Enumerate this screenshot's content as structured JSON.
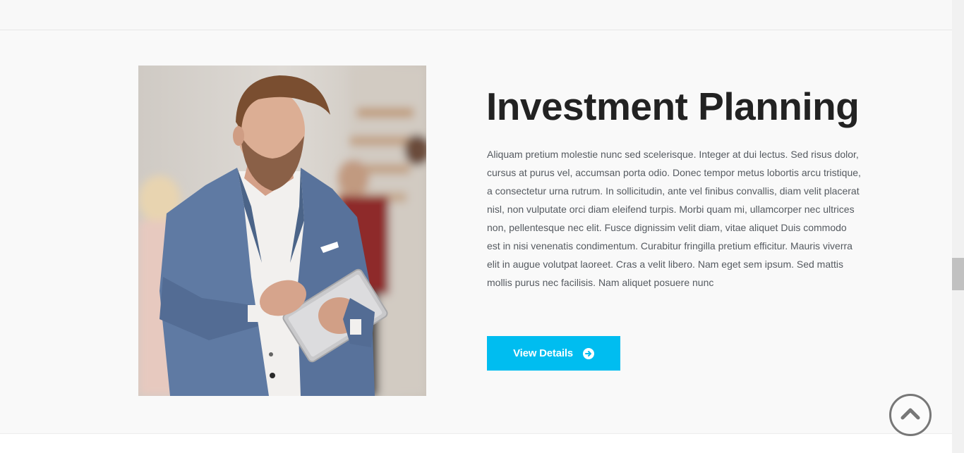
{
  "section": {
    "title": "Investment Planning",
    "description": "Aliquam pretium molestie nunc sed scelerisque. Integer at dui lectus. Sed risus dolor, cursus at purus vel, accumsan porta odio. Donec tempor metus lobortis arcu tristique, a consectetur urna rutrum. In sollicitudin, ante vel finibus convallis, diam velit placerat nisl, non vulputate orci diam eleifend turpis. Morbi quam mi, ullamcorper nec ultrices non, pellentesque nec elit. Fusce dignissim velit diam, vitae aliquet Duis commodo est in nisi venenatis condimentum. Curabitur fringilla pretium efficitur. Mauris viverra elit in augue volutpat laoreet. Cras a velit libero. Nam eget sem ipsum. Sed mattis mollis purus nec facilisis. Nam aliquet posuere nunc",
    "button_label": "View Details",
    "button_icon": "arrow-circle-right-icon",
    "image": "man-with-tablet-photo"
  },
  "back_to_top": {
    "icon": "chevron-up-icon"
  },
  "colors": {
    "accent": "#00bdf0",
    "title": "#222222",
    "body_text": "#555a60",
    "background": "#f9f9f9"
  }
}
